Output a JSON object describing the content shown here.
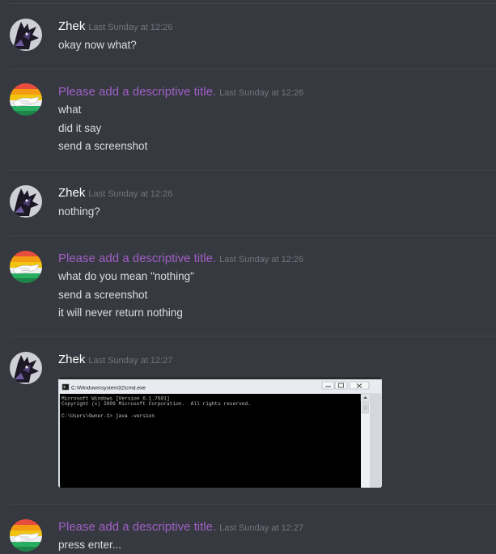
{
  "messages": [
    {
      "author": "Zhek",
      "author_color": "#ffffff",
      "timestamp": "Last Sunday at 12:26",
      "lines": [
        "okay now what?"
      ]
    },
    {
      "author": "Please add a descriptive title.",
      "author_color": "#a05fc6",
      "timestamp": "Last Sunday at 12:26",
      "lines": [
        "what",
        "did it say",
        "send a screenshot"
      ]
    },
    {
      "author": "Zhek",
      "author_color": "#ffffff",
      "timestamp": "Last Sunday at 12:26",
      "lines": [
        "nothing?"
      ]
    },
    {
      "author": "Please add a descriptive title.",
      "author_color": "#a05fc6",
      "timestamp": "Last Sunday at 12:26",
      "lines": [
        "what do you mean \"nothing\"",
        "send a screenshot",
        "it will never return nothing"
      ]
    },
    {
      "author": "Zhek",
      "author_color": "#ffffff",
      "timestamp": "Last Sunday at 12:27",
      "attachment": {
        "window_title": "C:\\Windows\\system32\\cmd.exe",
        "console_lines": [
          "Microsoft Windows [Version 6.1.7601]",
          "Copyright (c) 2009 Microsoft Corporation.  All rights reserved.",
          "",
          "C:\\Users\\Owner-1> java -version"
        ]
      }
    },
    {
      "author": "Please add a descriptive title.",
      "author_color": "#a05fc6",
      "timestamp": "Last Sunday at 12:27",
      "lines": [
        "press enter..."
      ]
    }
  ],
  "icons": {
    "zhek_avatar": "wolf-avatar-icon",
    "title_avatar": "rainbow-hand-avatar-icon",
    "minimize": "minimize-icon",
    "maximize": "maximize-icon",
    "close": "close-icon",
    "console": "console-icon"
  },
  "colors": {
    "background": "#36393f",
    "divider": "#42454a",
    "text": "#dcddde",
    "timestamp": "#72767d",
    "purple_author": "#a05fc6"
  }
}
